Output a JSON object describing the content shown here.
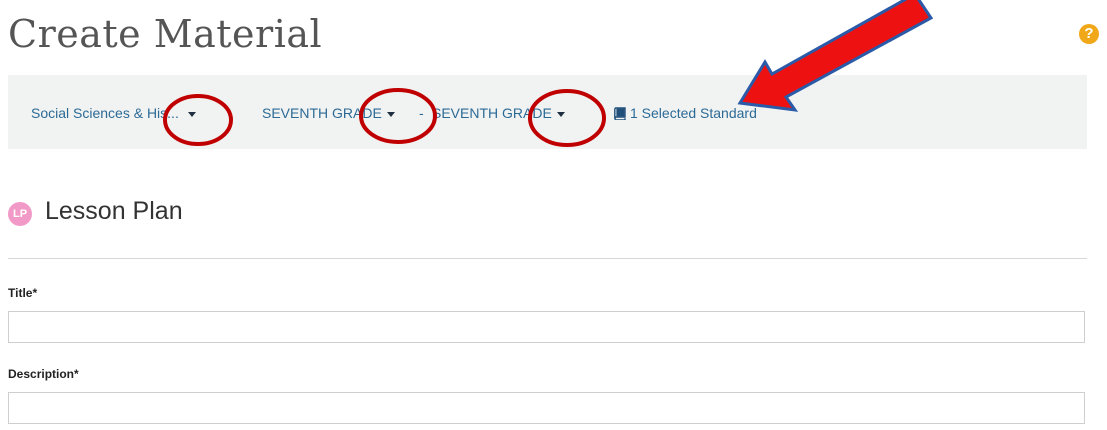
{
  "page": {
    "title": "Create Material"
  },
  "help": {
    "glyph": "?"
  },
  "filters": {
    "subject": "Social Sciences & His...",
    "grade_from": "SEVENTH GRADE",
    "separator": "-",
    "grade_to": "SEVENTH GRADE",
    "standards": "1 Selected Standard"
  },
  "material": {
    "badge": "LP",
    "type": "Lesson Plan"
  },
  "form": {
    "title_label": "Title*",
    "title_value": "",
    "description_label": "Description*",
    "description_value": ""
  },
  "colors": {
    "link": "#2c6a96",
    "help": "#f0a818",
    "badge": "#f29ac7",
    "annotation_red": "#c00000",
    "arrow_fill": "#ee1111",
    "arrow_outline": "#2a5aa8"
  },
  "icons": {
    "help": "question-circle-icon",
    "caret": "caret-down-icon",
    "standards": "book-icon"
  }
}
